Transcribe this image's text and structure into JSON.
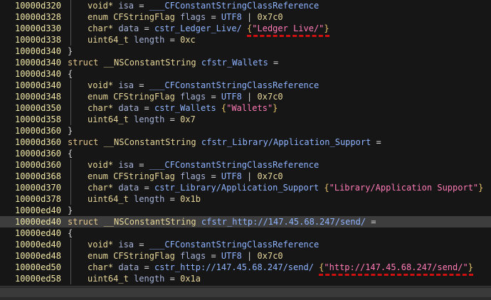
{
  "rows": [
    {
      "addr": "10000d320",
      "kind": "field",
      "a": "void*",
      "b": "isa",
      "c": "=",
      "d": "___CFConstantStringClassReference"
    },
    {
      "addr": "10000d328",
      "kind": "field",
      "a": "enum",
      "a2": "CFStringFlag",
      "b": "flags",
      "c": "=",
      "d": "UTF8",
      "d2": "|",
      "d3": "0x7c0"
    },
    {
      "addr": "10000d330",
      "kind": "data",
      "a": "char*",
      "b": "data",
      "c": "=",
      "d": "cstr_Ledger_Live/",
      "s": "\"Ledger Live/\""
    },
    {
      "addr": "10000d338",
      "kind": "field",
      "a": "uint64_t",
      "b": "length",
      "c": "=",
      "d3": "0xc"
    },
    {
      "addr": "10000d340",
      "kind": "close",
      "text": "}"
    },
    {
      "addr": "10000d340",
      "kind": "struct",
      "kw": "struct",
      "t": "__NSConstantString",
      "name": "cfstr_Wallets",
      "eq": "="
    },
    {
      "addr": "10000d340",
      "kind": "open",
      "text": "{"
    },
    {
      "addr": "10000d340",
      "kind": "field",
      "a": "void*",
      "b": "isa",
      "c": "=",
      "d": "___CFConstantStringClassReference"
    },
    {
      "addr": "10000d348",
      "kind": "field",
      "a": "enum",
      "a2": "CFStringFlag",
      "b": "flags",
      "c": "=",
      "d": "UTF8",
      "d2": "|",
      "d3": "0x7c0"
    },
    {
      "addr": "10000d350",
      "kind": "data",
      "a": "char*",
      "b": "data",
      "c": "=",
      "d": "cstr_Wallets",
      "s": "\"Wallets\""
    },
    {
      "addr": "10000d358",
      "kind": "field",
      "a": "uint64_t",
      "b": "length",
      "c": "=",
      "d3": "0x7"
    },
    {
      "addr": "10000d360",
      "kind": "close",
      "text": "}"
    },
    {
      "addr": "10000d360",
      "kind": "struct",
      "kw": "struct",
      "t": "__NSConstantString",
      "name": "cfstr_Library/Application_Support",
      "eq": "="
    },
    {
      "addr": "10000d360",
      "kind": "open",
      "text": "{"
    },
    {
      "addr": "10000d360",
      "kind": "field",
      "a": "void*",
      "b": "isa",
      "c": "=",
      "d": "___CFConstantStringClassReference"
    },
    {
      "addr": "10000d368",
      "kind": "field",
      "a": "enum",
      "a2": "CFStringFlag",
      "b": "flags",
      "c": "=",
      "d": "UTF8",
      "d2": "|",
      "d3": "0x7c0"
    },
    {
      "addr": "10000d370",
      "kind": "data",
      "a": "char*",
      "b": "data",
      "c": "=",
      "d": "cstr_Library/Application_Support",
      "s": "\"Library/Application Support\""
    },
    {
      "addr": "10000d378",
      "kind": "field",
      "a": "uint64_t",
      "b": "length",
      "c": "=",
      "d3": "0x1b"
    },
    {
      "addr": "10000ed40",
      "kind": "close",
      "text": "}"
    },
    {
      "addr": "10000ed40",
      "kind": "struct",
      "kw": "struct",
      "t": "__NSConstantString",
      "name": "cfstr_http://147.45.68.247/send/",
      "eq": "=",
      "selected": true
    },
    {
      "addr": "10000ed40",
      "kind": "open",
      "text": "{"
    },
    {
      "addr": "10000ed40",
      "kind": "field",
      "a": "void*",
      "b": "isa",
      "c": "=",
      "d": "___CFConstantStringClassReference"
    },
    {
      "addr": "10000ed48",
      "kind": "field",
      "a": "enum",
      "a2": "CFStringFlag",
      "b": "flags",
      "c": "=",
      "d": "UTF8",
      "d2": "|",
      "d3": "0x7c0"
    },
    {
      "addr": "10000ed50",
      "kind": "data",
      "a": "char*",
      "b": "data",
      "c": "=",
      "d": "cstr_http://147.45.68.247/send/",
      "s": "\"http://147.45.68.247/send/\""
    },
    {
      "addr": "10000ed58",
      "kind": "field",
      "a": "uint64_t",
      "b": "length",
      "c": "=",
      "d3": "0x1a"
    }
  ],
  "annotations": {
    "color": "#d01010",
    "underlined_rows": [
      2,
      23
    ]
  }
}
